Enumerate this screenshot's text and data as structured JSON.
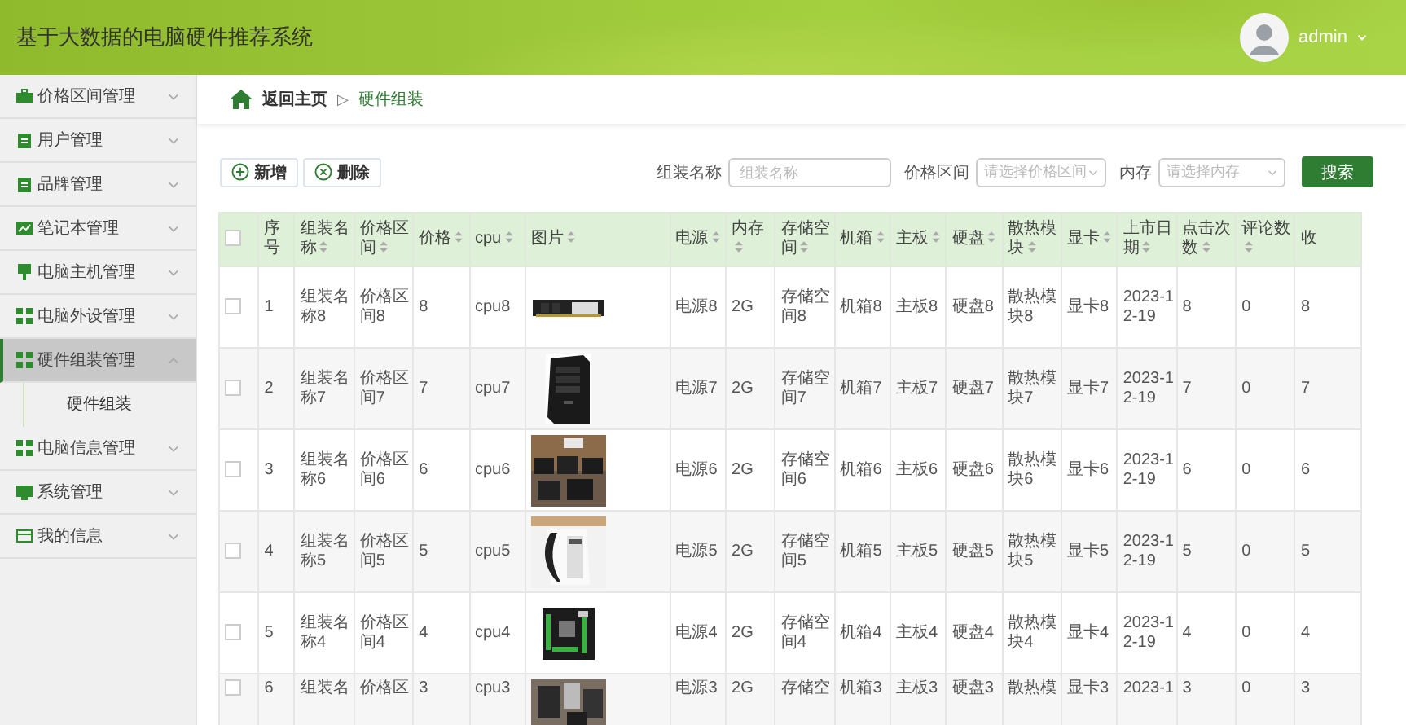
{
  "app": {
    "title": "基于大数据的电脑硬件推荐系统",
    "user": "admin"
  },
  "sidebar": {
    "items": [
      {
        "label": "价格区间管理",
        "expanded": false
      },
      {
        "label": "用户管理",
        "expanded": false
      },
      {
        "label": "品牌管理",
        "expanded": false
      },
      {
        "label": "笔记本管理",
        "expanded": false
      },
      {
        "label": "电脑主机管理",
        "expanded": false
      },
      {
        "label": "电脑外设管理",
        "expanded": false
      },
      {
        "label": "硬件组装管理",
        "expanded": true,
        "children": [
          {
            "label": "硬件组装"
          }
        ]
      },
      {
        "label": "电脑信息管理",
        "expanded": false
      },
      {
        "label": "系统管理",
        "expanded": false
      },
      {
        "label": "我的信息",
        "expanded": false
      }
    ]
  },
  "breadcrumb": {
    "home": "返回主页",
    "separator": "▷",
    "current": "硬件组装"
  },
  "toolbar": {
    "buttons": [
      {
        "label": "新增",
        "kind": "add"
      },
      {
        "label": "删除",
        "kind": "delete"
      }
    ],
    "filters": [
      {
        "label": "组装名称",
        "kind": "input",
        "placeholder": "组装名称"
      },
      {
        "label": "价格区间",
        "kind": "select",
        "placeholder": "请选择价格区间"
      },
      {
        "label": "内存",
        "kind": "select",
        "placeholder": "请选择内存"
      }
    ],
    "search": "搜索"
  },
  "table": {
    "header_checked": false,
    "columns": [
      "序号",
      "组装名称",
      "价格区间",
      "价格",
      "cpu",
      "图片",
      "电源",
      "内存",
      "存储空间",
      "机箱",
      "主板",
      "硬盘",
      "散热模块",
      "显卡",
      "上市日期",
      "点击次数",
      "评论数",
      "收"
    ],
    "rows": [
      {
        "checked": false,
        "cells": [
          "1",
          "组装名称8",
          "价格区间8",
          "8",
          "cpu8",
          {
            "kind": "picture"
          },
          "电源8",
          "2G",
          "存储空间8",
          "机箱8",
          "主板8",
          "硬盘8",
          "散热模块8",
          "显卡8",
          "2023-12-19",
          "8",
          "0",
          "8"
        ]
      },
      {
        "checked": false,
        "cells": [
          "2",
          "组装名称7",
          "价格区间7",
          "7",
          "cpu7",
          {
            "kind": "picture"
          },
          "电源7",
          "2G",
          "存储空间7",
          "机箱7",
          "主板7",
          "硬盘7",
          "散热模块7",
          "显卡7",
          "2023-12-19",
          "7",
          "0",
          "7"
        ]
      },
      {
        "checked": false,
        "cells": [
          "3",
          "组装名称6",
          "价格区间6",
          "6",
          "cpu6",
          {
            "kind": "picture"
          },
          "电源6",
          "2G",
          "存储空间6",
          "机箱6",
          "主板6",
          "硬盘6",
          "散热模块6",
          "显卡6",
          "2023-12-19",
          "6",
          "0",
          "6"
        ]
      },
      {
        "checked": false,
        "cells": [
          "4",
          "组装名称5",
          "价格区间5",
          "5",
          "cpu5",
          {
            "kind": "picture"
          },
          "电源5",
          "2G",
          "存储空间5",
          "机箱5",
          "主板5",
          "硬盘5",
          "散热模块5",
          "显卡5",
          "2023-12-19",
          "5",
          "0",
          "5"
        ]
      },
      {
        "checked": false,
        "cells": [
          "5",
          "组装名称4",
          "价格区间4",
          "4",
          "cpu4",
          {
            "kind": "picture"
          },
          "电源4",
          "2G",
          "存储空间4",
          "机箱4",
          "主板4",
          "硬盘4",
          "散热模块4",
          "显卡4",
          "2023-12-19",
          "4",
          "0",
          "4"
        ]
      },
      {
        "checked": false,
        "cells": [
          "6",
          "组装名",
          "价格区",
          "3",
          "cpu3",
          {
            "kind": "picture"
          },
          "电源3",
          "2G",
          "存储空",
          "机箱3",
          "主板3",
          "硬盘3",
          "散热模",
          "显卡3",
          "2023-1",
          "3",
          "0",
          "3"
        ]
      }
    ]
  }
}
